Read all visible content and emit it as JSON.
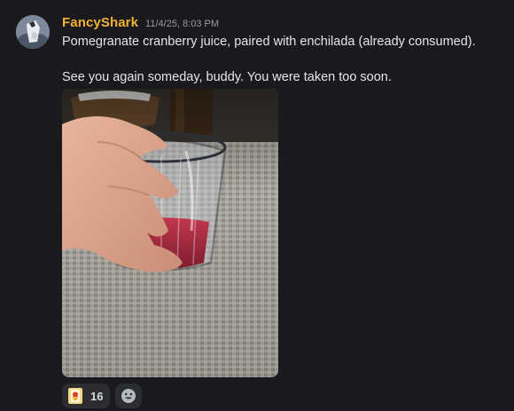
{
  "message": {
    "author": "FancyShark",
    "timestamp": "11/4/25, 8:03 PM",
    "lines": [
      "Pomegranate cranberry juice, paired with enchilada (already consumed).",
      "See you again someday, buddy. You were taken too soon."
    ]
  },
  "reactions": [
    {
      "emoji": "emoji-image-icon",
      "count": "16"
    }
  ],
  "add_reaction_icon": "smiley-add-reaction-icon",
  "colors": {
    "background": "#1a1a1e",
    "username": "#f0b232",
    "timestamp": "#949ba4",
    "text": "#e3e5e8",
    "reaction_bg": "#2b2d31"
  }
}
